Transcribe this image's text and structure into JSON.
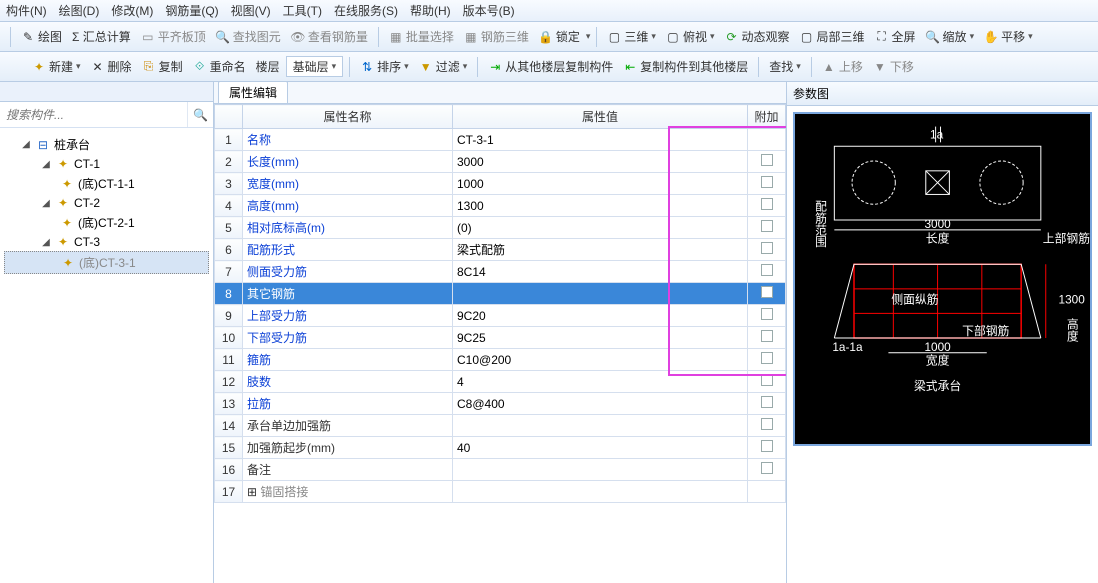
{
  "menu": [
    "构件(N)",
    "绘图(D)",
    "修改(M)",
    "钢筋量(Q)",
    "视图(V)",
    "工具(T)",
    "在线服务(S)",
    "帮助(H)",
    "版本号(B)"
  ],
  "toolbar1": {
    "draw": "绘图",
    "sigma": "Σ 汇总计算",
    "pingqi": "平齐板顶",
    "chazhao": "查找图元",
    "chakan": "查看钢筋量",
    "piliang": "批量选择",
    "sanwei": "钢筋三维",
    "lock": "锁定",
    "sanwei2": "三维",
    "fushi": "俯视",
    "dongtai": "动态观察",
    "jubu": "局部三维",
    "quanping": "全屏",
    "suofang": "缩放",
    "pingyi": "平移"
  },
  "toolbar2": {
    "xinjian": "新建",
    "shanchu": "删除",
    "fuzhi": "复制",
    "chongming": "重命名",
    "louceng": "楼层",
    "jichu": "基础层",
    "paixu": "排序",
    "guolv": "过滤",
    "congqita": "从其他楼层复制构件",
    "fuzhidao": "复制构件到其他楼层",
    "chazhao": "查找",
    "shangyi": "上移",
    "xiayi": "下移"
  },
  "search_placeholder": "搜索构件...",
  "tree": {
    "root": "桩承台",
    "n1": "CT-1",
    "n1c": "(底)CT-1-1",
    "n2": "CT-2",
    "n2c": "(底)CT-2-1",
    "n3": "CT-3",
    "n3c": "(底)CT-3-1"
  },
  "ctab": "属性编辑",
  "grid_headers": {
    "name": "属性名称",
    "value": "属性值",
    "add": "附加"
  },
  "rows": [
    {
      "n": "1",
      "name": "名称",
      "value": "CT-3-1",
      "link": true,
      "chk": false
    },
    {
      "n": "2",
      "name": "长度(mm)",
      "value": "3000",
      "link": true,
      "chk": true
    },
    {
      "n": "3",
      "name": "宽度(mm)",
      "value": "1000",
      "link": true,
      "chk": true
    },
    {
      "n": "4",
      "name": "高度(mm)",
      "value": "1300",
      "link": true,
      "chk": true
    },
    {
      "n": "5",
      "name": "相对底标高(m)",
      "value": "(0)",
      "link": true,
      "chk": true
    },
    {
      "n": "6",
      "name": "配筋形式",
      "value": "梁式配筋",
      "link": true,
      "chk": true
    },
    {
      "n": "7",
      "name": "侧面受力筋",
      "value": "8C14",
      "link": true,
      "chk": true
    },
    {
      "n": "8",
      "name": "其它钢筋",
      "value": "",
      "link": true,
      "chk": true,
      "sel": true
    },
    {
      "n": "9",
      "name": "上部受力筋",
      "value": "9C20",
      "link": true,
      "chk": true
    },
    {
      "n": "10",
      "name": "下部受力筋",
      "value": "9C25",
      "link": true,
      "chk": true
    },
    {
      "n": "11",
      "name": "箍筋",
      "value": "C10@200",
      "link": true,
      "chk": true
    },
    {
      "n": "12",
      "name": "肢数",
      "value": "4",
      "link": true,
      "chk": true
    },
    {
      "n": "13",
      "name": "拉筋",
      "value": "C8@400",
      "link": true,
      "chk": true
    },
    {
      "n": "14",
      "name": "承台单边加强筋",
      "value": "",
      "link": false,
      "chk": true
    },
    {
      "n": "15",
      "name": "加强筋起步(mm)",
      "value": "40",
      "link": false,
      "chk": true
    },
    {
      "n": "16",
      "name": "备注",
      "value": "",
      "link": false,
      "chk": true
    },
    {
      "n": "17",
      "name": "锚固搭接",
      "value": "",
      "link": false,
      "chk": false,
      "expand": true,
      "grey": true
    }
  ],
  "right_title": "参数图",
  "diagram": {
    "top_len": "3000",
    "top_lbl": "长度",
    "top_right": "上部钢筋",
    "side_lbl": "侧面纵筋",
    "bot_lbl": "下部钢筋",
    "h": "1300",
    "side_h": "高度",
    "bot_len": "1000",
    "bot_w": "宽度",
    "title": "梁式承台",
    "la": "1a-1a",
    "peijin": "配筋范围"
  }
}
